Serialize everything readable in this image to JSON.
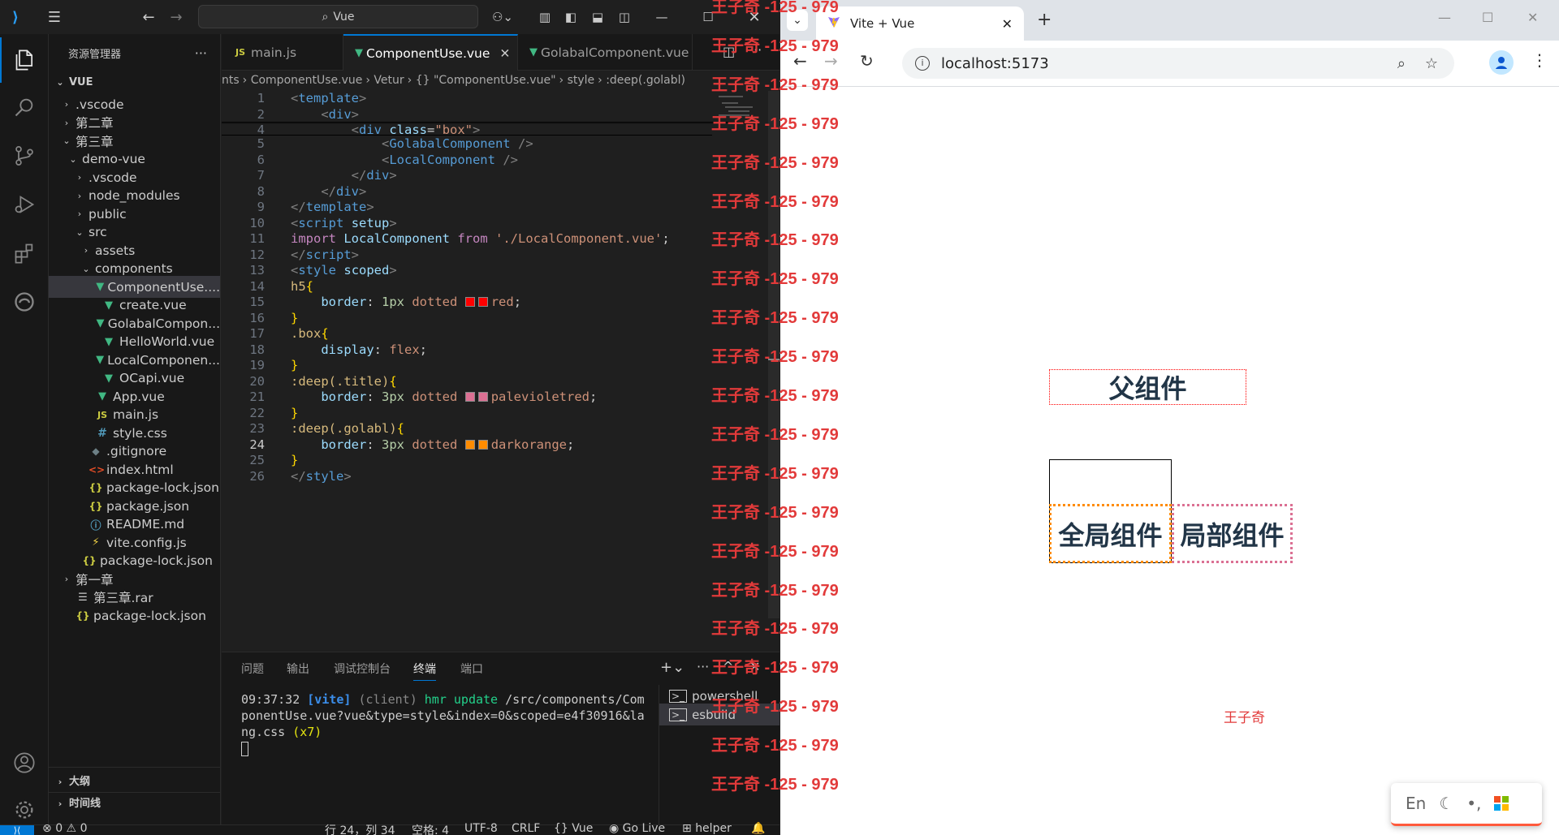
{
  "vscode": {
    "search_text": "Vue",
    "explorer_title": "资源管理器",
    "root_folder": "VUE",
    "tree": [
      {
        "label": ".vscode",
        "kind": "folder",
        "open": false,
        "depth": 1
      },
      {
        "label": "第二章",
        "kind": "folder",
        "open": false,
        "depth": 1
      },
      {
        "label": "第三章",
        "kind": "folder",
        "open": true,
        "depth": 1
      },
      {
        "label": "demo-vue",
        "kind": "folder",
        "open": true,
        "depth": 2
      },
      {
        "label": ".vscode",
        "kind": "folder",
        "open": false,
        "depth": 3
      },
      {
        "label": "node_modules",
        "kind": "folder",
        "open": false,
        "depth": 3
      },
      {
        "label": "public",
        "kind": "folder",
        "open": false,
        "depth": 3
      },
      {
        "label": "src",
        "kind": "folder",
        "open": true,
        "depth": 3
      },
      {
        "label": "assets",
        "kind": "folder",
        "open": false,
        "depth": 4
      },
      {
        "label": "components",
        "kind": "folder",
        "open": true,
        "depth": 4
      },
      {
        "label": "ComponentUse....",
        "kind": "vue",
        "depth": 5,
        "selected": true
      },
      {
        "label": "create.vue",
        "kind": "vue",
        "depth": 5
      },
      {
        "label": "GolabalCompon...",
        "kind": "vue",
        "depth": 5
      },
      {
        "label": "HelloWorld.vue",
        "kind": "vue",
        "depth": 5
      },
      {
        "label": "LocalComponen...",
        "kind": "vue",
        "depth": 5
      },
      {
        "label": "OCapi.vue",
        "kind": "vue",
        "depth": 5
      },
      {
        "label": "App.vue",
        "kind": "vue",
        "depth": 4
      },
      {
        "label": "main.js",
        "kind": "js",
        "depth": 4
      },
      {
        "label": "style.css",
        "kind": "css",
        "depth": 4
      },
      {
        "label": ".gitignore",
        "kind": "git",
        "depth": 3
      },
      {
        "label": "index.html",
        "kind": "html",
        "depth": 3
      },
      {
        "label": "package-lock.json",
        "kind": "json",
        "depth": 3
      },
      {
        "label": "package.json",
        "kind": "json",
        "depth": 3
      },
      {
        "label": "README.md",
        "kind": "info",
        "depth": 3
      },
      {
        "label": "vite.config.js",
        "kind": "bolt",
        "depth": 3
      },
      {
        "label": "package-lock.json",
        "kind": "json",
        "depth": 2
      },
      {
        "label": "第一章",
        "kind": "folder",
        "open": false,
        "depth": 1
      },
      {
        "label": "第三章.rar",
        "kind": "rar",
        "depth": 1
      },
      {
        "label": "package-lock.json",
        "kind": "json",
        "depth": 1
      }
    ],
    "outline_label": "大纲",
    "timeline_label": "时间线",
    "tabs": [
      {
        "label": "main.js",
        "icon": "JS"
      },
      {
        "label": "ComponentUse.vue",
        "icon": "V",
        "active": true
      },
      {
        "label": "GolabalComponent.vue",
        "icon": "V"
      }
    ],
    "breadcrumb": [
      "nts",
      "ComponentUse.vue",
      "Vetur",
      "{} \"ComponentUse.vue\"",
      "style",
      ":deep(.golabl)"
    ],
    "line_numbers": [
      "1",
      "2",
      "4",
      "5",
      "6",
      "7",
      "8",
      "9",
      "10",
      "11",
      "12",
      "13",
      "14",
      "15",
      "16",
      "17",
      "18",
      "19",
      "20",
      "21",
      "22",
      "23",
      "24",
      "25",
      "26"
    ],
    "current_line": "24",
    "panel_tabs": [
      "问题",
      "输出",
      "调试控制台",
      "终端",
      "端口"
    ],
    "active_panel_tab": "终端",
    "terminal_lines": [
      "09:37:32 [vite] (client) hmr update /src/components/Com",
      "ponentUse.vue?vue&type=style&index=0&scoped=e4f30916&la",
      "ng.css (x7)"
    ],
    "terminal_list": [
      "powershell",
      "esbuild"
    ],
    "status": {
      "errors": "0",
      "warnings": "0",
      "position": "行 24，列 34",
      "spaces": "空格: 4",
      "encoding": "UTF-8",
      "eol": "CRLF",
      "language": "Vue",
      "golive": "Go Live",
      "helper": "helper"
    }
  },
  "browser": {
    "tab_title": "Vite + Vue",
    "url": "localhost:5173",
    "parent_label": "父组件",
    "global_label": "全局组件",
    "local_label": "局部组件",
    "footer_name": "王子奇",
    "watermark": "王子奇 -125 - 979",
    "ime": {
      "lang": "En"
    }
  },
  "colors": {
    "accent": "#0078d4",
    "red": "#ff0000",
    "palevioletred": "#db7093",
    "darkorange": "#ff8c00",
    "vue_green": "#41b883"
  }
}
